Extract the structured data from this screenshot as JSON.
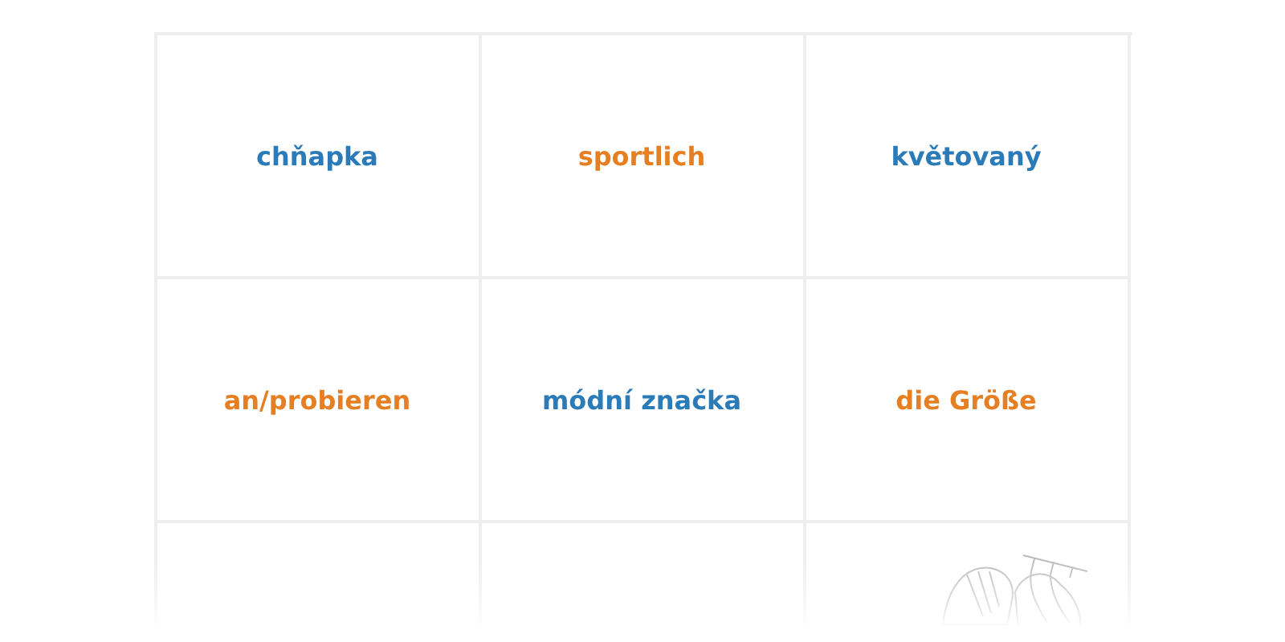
{
  "cards": [
    {
      "word": "chňapka",
      "color": "#2b7bb9"
    },
    {
      "word": "sportlich",
      "color": "#e67e22"
    },
    {
      "word": "květovaný",
      "color": "#2b7bb9"
    },
    {
      "word": "an/probieren",
      "color": "#e67e22"
    },
    {
      "word": "módní značka",
      "color": "#2b7bb9"
    },
    {
      "word": "die Größe",
      "color": "#e67e22"
    },
    {
      "kind": "blank"
    },
    {
      "kind": "blank"
    },
    {
      "kind": "picture"
    }
  ]
}
